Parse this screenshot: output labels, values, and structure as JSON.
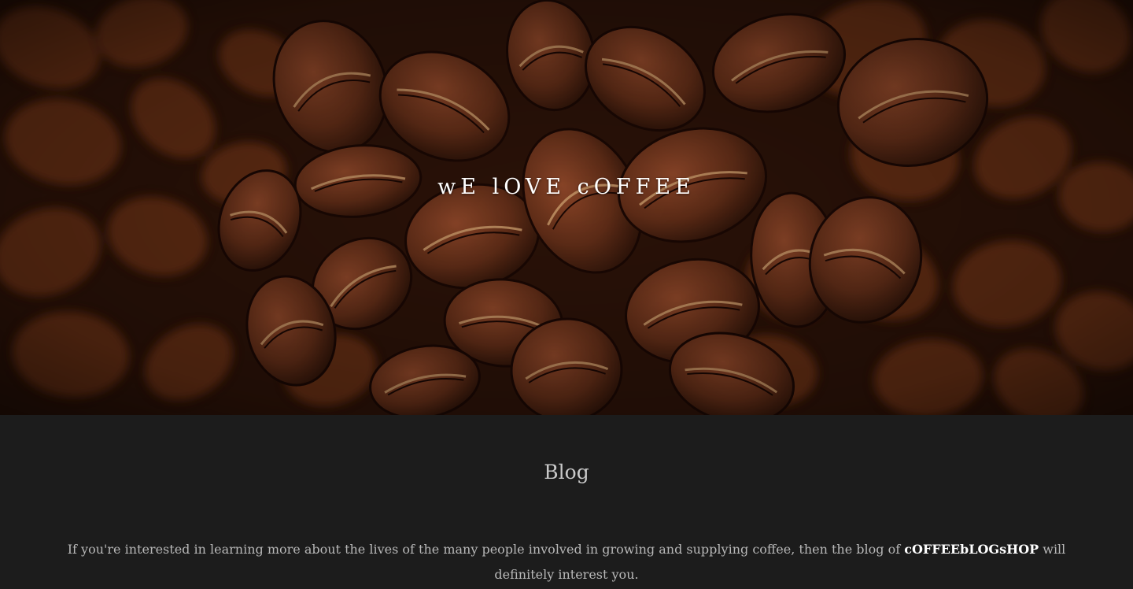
{
  "hero": {
    "title": "wE lOVE cOFFEE",
    "image_icon": "coffee-beans-photo",
    "colors": {
      "bean_dark": "#3a1a0d",
      "bean_mid": "#5e2c17",
      "bean_light": "#8a4528",
      "crease": "#c79a6a"
    }
  },
  "blog": {
    "heading": "Blog",
    "text_before": "If you're interested in learning more about the lives of the many people involved in growing and supplying coffee, then the blog of ",
    "brand": "cOFFEEbLOGsHOP",
    "text_after": " will definitely interest you."
  },
  "colors": {
    "background": "#1c1c1c",
    "heading": "#c9c9c9",
    "body_text": "#b8b8b8"
  }
}
